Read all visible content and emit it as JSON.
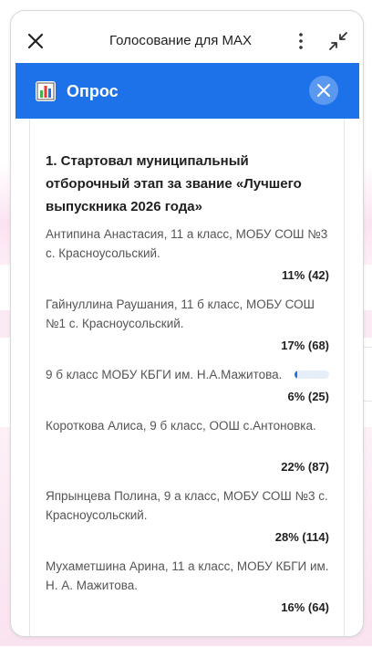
{
  "titlebar": {
    "title": "Голосование для MAX",
    "icons": {
      "close": "close-icon",
      "more": "more-vertical-icon",
      "collapse": "collapse-icon"
    }
  },
  "poll": {
    "header_title": "Опрос",
    "header_icon": "bar-chart-icon",
    "accent_color": "#1d72ea",
    "question": "1. Стартовал муниципальный отборочный этап за звание «Лучшего выпускника 2026 года»",
    "options": [
      {
        "label": "Антипина Анастасия, 11 а класс, МОБУ СОШ №3 с. Красноусольский.",
        "result": "11% (42)"
      },
      {
        "label": "Гайнуллина Раушания, 11 б класс, МОБУ СОШ №1 с. Красноусольский.",
        "result": "17% (68)"
      },
      {
        "label": "9 б класс МОБУ КБГИ им. Н.А.Мажитова.",
        "result": "6% (25)",
        "fraction": 0.06
      },
      {
        "label": "Короткова Алиса, 9 б класс, ООШ с.Антоновка.",
        "result": "22% (87)"
      },
      {
        "label": "Япрынцева Полина, 9 а класс, МОБУ СОШ №3 с. Красноусольский.",
        "result": "28% (114)"
      },
      {
        "label": "Мухаметшина Арина, 11 а класс, МОБУ КБГИ им. Н. А. Мажитова.",
        "result": "16% (64)"
      }
    ]
  }
}
